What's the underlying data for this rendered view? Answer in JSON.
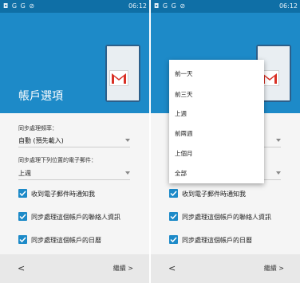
{
  "status_bar": {
    "left_icons": "◘ G G ⊘",
    "time": "06:12",
    "signal": "ᯤ ▌ ▌"
  },
  "header": {
    "title": "帳戶選項"
  },
  "sync_frequency": {
    "label": "同步處理頻率：",
    "value": "自動 (預先載入)"
  },
  "sync_from": {
    "label": "同步處理下列位置的電子郵件：",
    "value": "上週"
  },
  "checkboxes": [
    {
      "label": "收到電子郵件時通知我",
      "checked": true
    },
    {
      "label": "同步處理這個帳戶的聯絡人資訊",
      "checked": true
    },
    {
      "label": "同步處理這個帳戶的日曆",
      "checked": true
    }
  ],
  "nav": {
    "prev": "<",
    "next": "繼續 >"
  },
  "dropdown": {
    "options": [
      "前一天",
      "前三天",
      "上週",
      "前兩週",
      "上個月",
      "全部"
    ]
  },
  "colors": {
    "header_blue": "#1d8ac8",
    "status_blue": "#0f6fa6",
    "checkbox_blue": "#1d8ac8",
    "gmail_red": "#d93025"
  }
}
